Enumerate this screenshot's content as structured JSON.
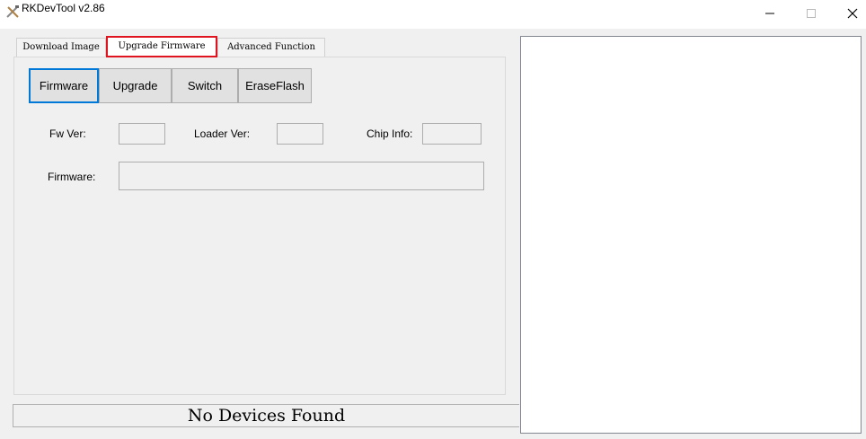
{
  "window": {
    "title": "RKDevTool v2.86",
    "icon": "tools-icon",
    "controls": {
      "minimize": "minimize-icon",
      "maximize": "maximize-icon",
      "close": "close-icon"
    }
  },
  "tabs": [
    {
      "label": "Download Image",
      "active": false
    },
    {
      "label": "Upgrade Firmware",
      "active": true
    },
    {
      "label": "Advanced Function",
      "active": false
    }
  ],
  "buttons": {
    "firmware": "Firmware",
    "upgrade": "Upgrade",
    "switch": "Switch",
    "erase_flash": "EraseFlash"
  },
  "info": {
    "fw_ver_label": "Fw Ver:",
    "fw_ver_value": "",
    "loader_ver_label": "Loader Ver:",
    "loader_ver_value": "",
    "chip_info_label": "Chip Info:",
    "chip_info_value": "",
    "firmware_label": "Firmware:",
    "firmware_value": ""
  },
  "status": "No Devices Found",
  "colors": {
    "highlight": "#e0141e",
    "focus": "#0078d7",
    "background": "#f0f0f0"
  }
}
